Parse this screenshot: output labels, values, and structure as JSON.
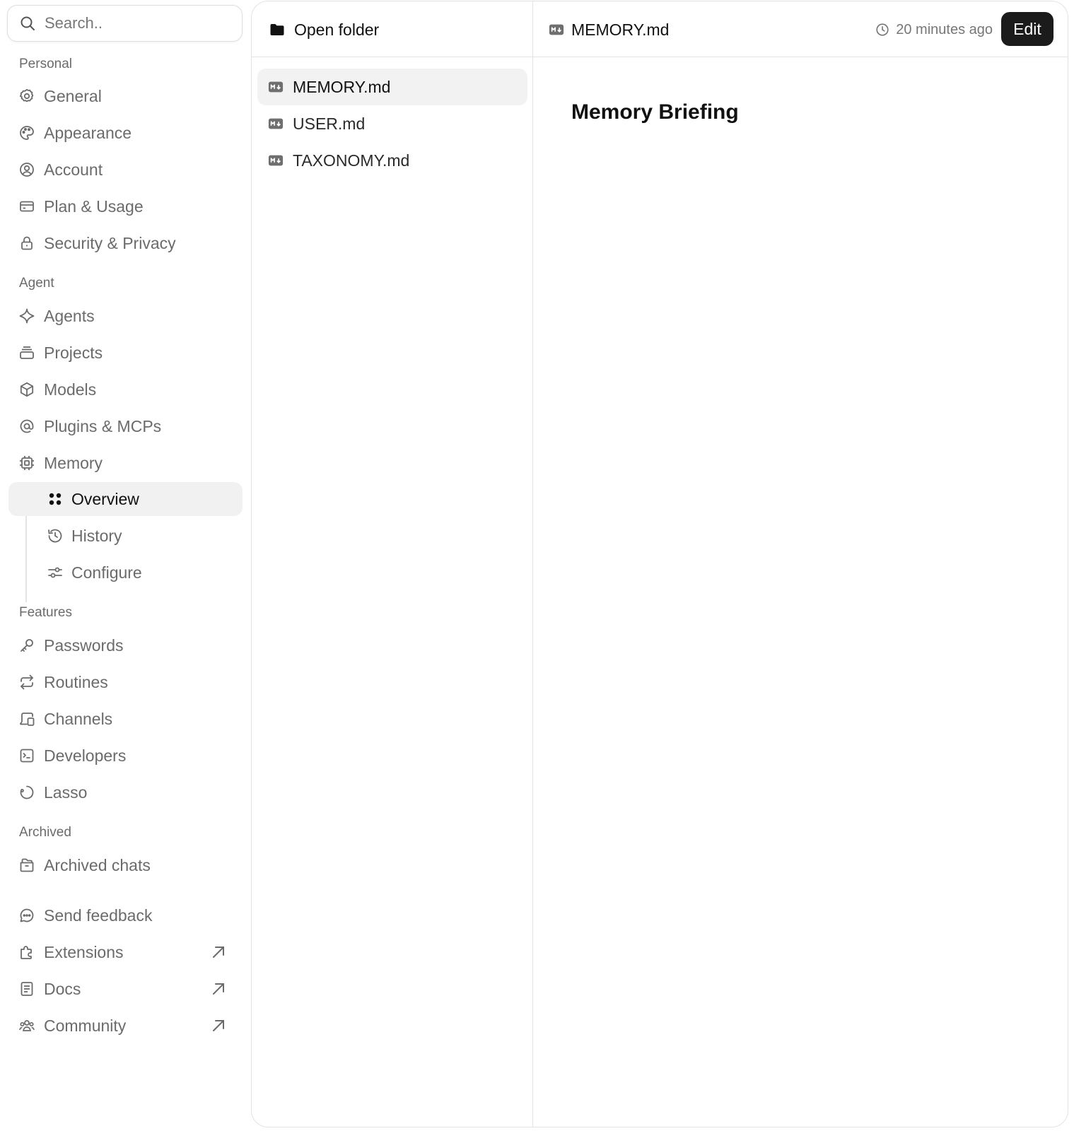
{
  "search": {
    "placeholder": "Search.."
  },
  "sidebar": {
    "sections": {
      "personal": "Personal",
      "agent": "Agent",
      "features": "Features",
      "archived": "Archived"
    },
    "personal_items": [
      {
        "label": "General",
        "icon": "gear-icon"
      },
      {
        "label": "Appearance",
        "icon": "palette-icon"
      },
      {
        "label": "Account",
        "icon": "user-circle-icon"
      },
      {
        "label": "Plan & Usage",
        "icon": "credit-card-icon"
      },
      {
        "label": "Security & Privacy",
        "icon": "lock-icon"
      }
    ],
    "agent_items": [
      {
        "label": "Agents",
        "icon": "sparkle-icon"
      },
      {
        "label": "Projects",
        "icon": "stack-icon"
      },
      {
        "label": "Models",
        "icon": "cube-icon"
      },
      {
        "label": "Plugins & MCPs",
        "icon": "at-sign-icon"
      },
      {
        "label": "Memory",
        "icon": "chip-icon"
      }
    ],
    "memory_sub_items": [
      {
        "label": "Overview",
        "icon": "grid-dots-icon",
        "active": true
      },
      {
        "label": "History",
        "icon": "history-icon"
      },
      {
        "label": "Configure",
        "icon": "sliders-icon"
      }
    ],
    "feature_items": [
      {
        "label": "Passwords",
        "icon": "key-icon"
      },
      {
        "label": "Routines",
        "icon": "repeat-icon"
      },
      {
        "label": "Channels",
        "icon": "devices-icon"
      },
      {
        "label": "Developers",
        "icon": "terminal-icon"
      },
      {
        "label": "Lasso",
        "icon": "lasso-icon"
      }
    ],
    "archived_items": [
      {
        "label": "Archived chats",
        "icon": "archive-icon"
      }
    ],
    "footer_items": [
      {
        "label": "Send feedback",
        "icon": "chat-bubble-icon"
      },
      {
        "label": "Extensions",
        "icon": "puzzle-icon",
        "external": true
      },
      {
        "label": "Docs",
        "icon": "document-icon",
        "external": true
      },
      {
        "label": "Community",
        "icon": "users-icon",
        "external": true
      }
    ]
  },
  "files_pane": {
    "open_folder_label": "Open folder",
    "files": [
      {
        "name": "MEMORY.md",
        "active": true
      },
      {
        "name": "USER.md"
      },
      {
        "name": "TAXONOMY.md"
      }
    ]
  },
  "document": {
    "filename": "MEMORY.md",
    "updated": "20 minutes ago",
    "edit_label": "Edit",
    "heading": "Memory Briefing"
  },
  "colors": {
    "accent_button": "#1b1b1b",
    "nav_text": "#6b6b6b",
    "active_bg": "#f1f1f1",
    "border": "#e3e3e3"
  }
}
